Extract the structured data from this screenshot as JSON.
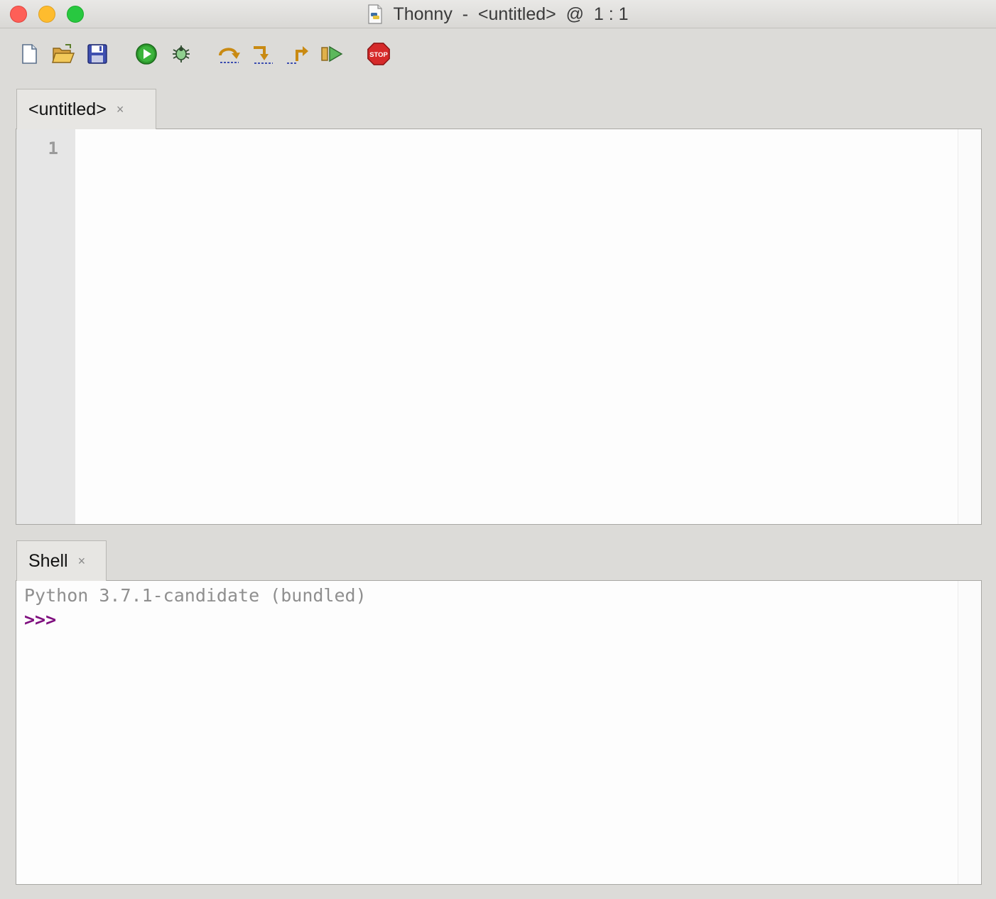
{
  "window": {
    "title": "Thonny  -  <untitled>  @  1 : 1",
    "icon": "python-document-icon"
  },
  "traffic_lights": {
    "close": "close-window-button",
    "minimize": "minimize-window-button",
    "zoom": "zoom-window-button"
  },
  "toolbar": {
    "buttons": [
      {
        "name": "new-file",
        "icon": "new-file-icon"
      },
      {
        "name": "open-file",
        "icon": "open-folder-icon"
      },
      {
        "name": "save-file",
        "icon": "floppy-save-icon"
      },
      {
        "name": "run",
        "icon": "run-play-icon"
      },
      {
        "name": "debug",
        "icon": "bug-debug-icon"
      },
      {
        "name": "step-over",
        "icon": "step-over-icon"
      },
      {
        "name": "step-into",
        "icon": "step-into-icon"
      },
      {
        "name": "step-out",
        "icon": "step-out-icon"
      },
      {
        "name": "resume",
        "icon": "resume-icon"
      },
      {
        "name": "stop",
        "icon": "stop-sign-icon",
        "label": "STOP"
      }
    ]
  },
  "editor": {
    "tab_label": "<untitled>",
    "tab_close": "×",
    "line_numbers": [
      "1"
    ],
    "content": ""
  },
  "shell": {
    "tab_label": "Shell",
    "tab_close": "×",
    "banner": "Python 3.7.1-candidate (bundled)",
    "prompt": ">>>"
  },
  "colors": {
    "chrome_bg": "#dcdbd8",
    "editor_bg": "#fdfdfd",
    "gutter_bg": "#e6e6e6",
    "prompt": "#7f0f7f",
    "banner_text": "#8f8f8f",
    "run_green": "#2e9a2e",
    "stop_red": "#d62a2a"
  }
}
